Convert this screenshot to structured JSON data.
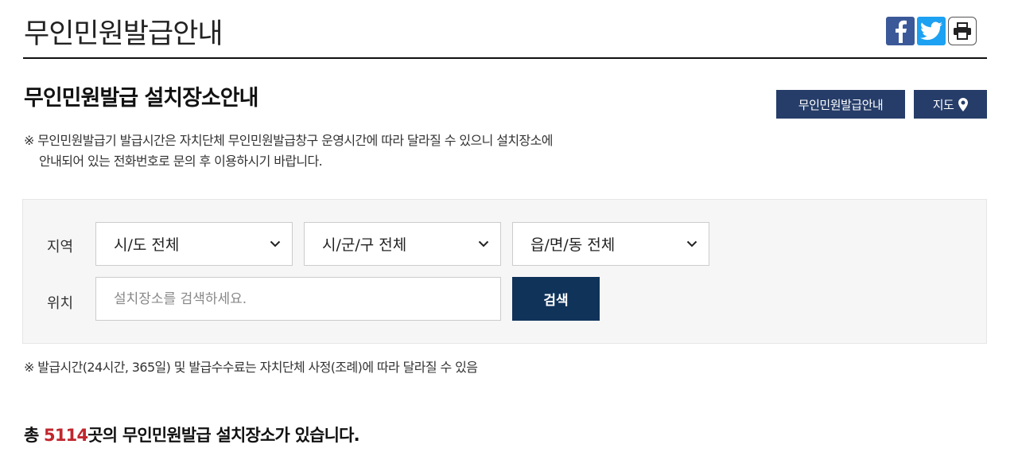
{
  "page": {
    "title": "무인민원발급안내"
  },
  "share": {
    "facebook_icon": "facebook-icon",
    "twitter_icon": "twitter-icon",
    "print_icon": "printer-icon"
  },
  "section": {
    "title": "무인민원발급 설치장소안내",
    "guide_button": "무인민원발급안내",
    "map_button": "지도",
    "notice_line1": "※ 무인민원발급기 발급시간은 자치단체 무인민원발급창구 운영시간에 따라 달라질 수 있으니 설치장소에",
    "notice_line2": "안내되어 있는 전화번호로 문의 후 이용하시기 바랍니다."
  },
  "search": {
    "region_label": "지역",
    "location_label": "위치",
    "sido": "시/도 전체",
    "sigungu": "시/군/구 전체",
    "eupmyeondong": "읍/면/동 전체",
    "placeholder": "설치장소를 검색하세요.",
    "button": "검색"
  },
  "fee_notice": "※ 발급시간(24시간, 365일) 및 발급수수료는 자치단체 사정(조례)에 따라 달라질 수 있음",
  "total": {
    "prefix": "총 ",
    "count": "5114",
    "suffix": "곳의 무인민원발급 설치장소가 있습니다."
  },
  "colors": {
    "navy": "#263d69",
    "search_button": "#10335a",
    "count": "#c0262d"
  }
}
